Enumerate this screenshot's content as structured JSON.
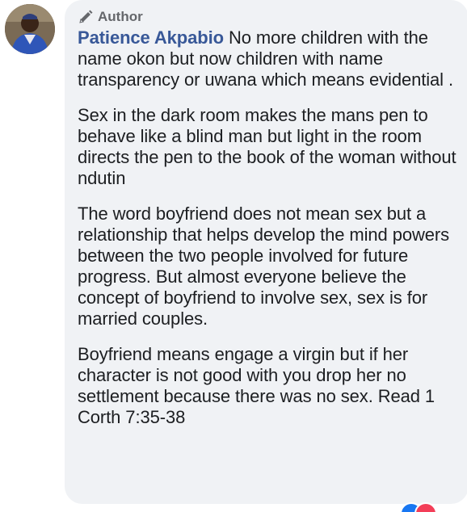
{
  "comment": {
    "author_badge": "Author",
    "author_name": "Patience Akpabio",
    "paragraphs": [
      " No more children with the name okon but now children with name transparency or uwana which means evidential .",
      "Sex in the dark room makes the mans pen to behave like a blind man but light in the room directs the pen to the book of the woman without ndutin",
      "The word boyfriend does not mean sex but a relationship that helps develop the mind powers between the two people involved for future progress. But almost everyone believe the concept of boyfriend to involve sex, sex is for married couples.",
      "Boyfriend means engage a virgin but if her character is not good with you drop her no settlement because there was no sex. Read 1 Corth 7:35-38"
    ],
    "icons": {
      "badge": "pen-icon",
      "reactions": [
        "like-icon",
        "love-icon"
      ]
    },
    "colors": {
      "bubble": "#f0f2f5",
      "name": "#385898",
      "text": "#1c1e21",
      "badge": "#65676b"
    }
  }
}
